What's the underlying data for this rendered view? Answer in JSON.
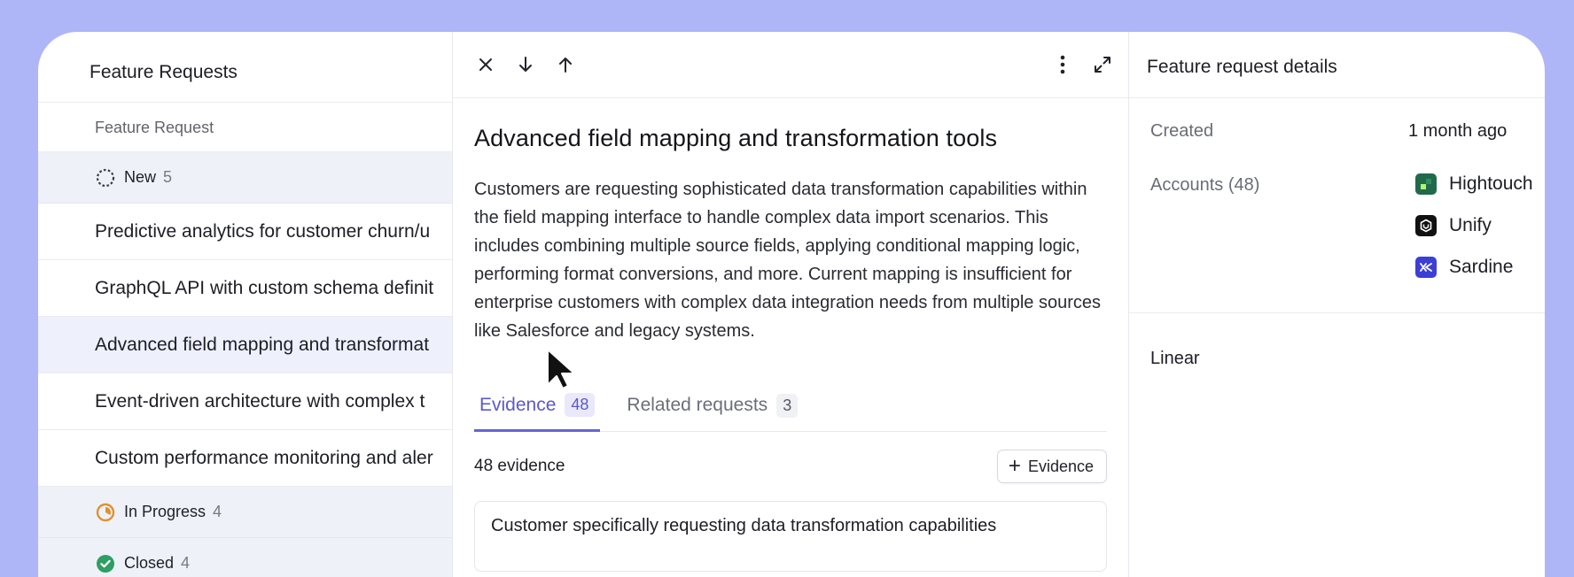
{
  "list": {
    "title": "Feature Requests",
    "column_header": "Feature Request",
    "groups": [
      {
        "status": "New",
        "count": "5"
      },
      {
        "status": "In Progress",
        "count": "4"
      },
      {
        "status": "Closed",
        "count": "4"
      }
    ],
    "items": [
      "Predictive analytics for customer churn/u",
      "GraphQL API with custom schema definit",
      "Advanced field mapping and transformat",
      "Event-driven architecture with complex t",
      "Custom performance monitoring and aler"
    ]
  },
  "detail": {
    "title": "Advanced field mapping and transformation tools",
    "description": "Customers are requesting sophisticated data transformation capabilities within the field mapping interface to handle complex data import scenarios. This includes combining multiple source fields, applying conditional mapping logic, performing format conversions, and more.  Current mapping is insufficient for enterprise customers with complex data integration needs from multiple sources like Salesforce and legacy systems.",
    "tabs": [
      {
        "label": "Evidence",
        "count": "48"
      },
      {
        "label": "Related requests",
        "count": "3"
      }
    ],
    "evidence_count": "48 evidence",
    "add_evidence_label": "Evidence",
    "evidence_card": "Customer specifically requesting data transformation capabilities"
  },
  "properties": {
    "title": "Feature request details",
    "created_label": "Created",
    "created_value": "1 month ago",
    "accounts_label": "Accounts (48)",
    "accounts": [
      "Hightouch",
      "Unify",
      "Sardine"
    ],
    "linear_label": "Linear"
  },
  "colors": {
    "background": "#afb6f7",
    "accent": "#5b59c9",
    "in_progress": "#e0912f",
    "closed": "#2f9e62",
    "hightouch": "#1f6a4a",
    "unify": "#111111",
    "sardine": "#3b3fd6"
  }
}
